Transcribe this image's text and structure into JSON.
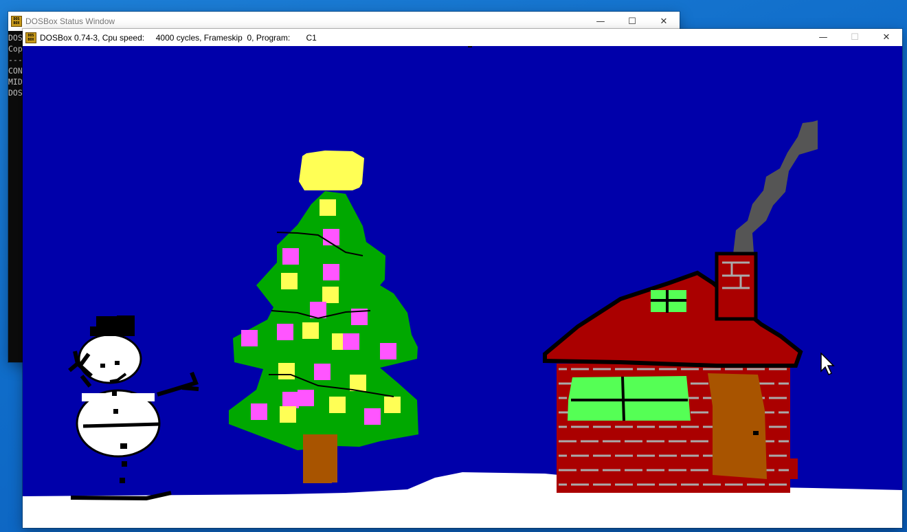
{
  "status_window": {
    "title": "DOSBox Status Window",
    "console_lines": [
      "DOS",
      "Cop",
      "---",
      "",
      "CON",
      "MID",
      "DOS"
    ],
    "controls": {
      "minimize": "—",
      "maximize": "☐",
      "close": "✕"
    }
  },
  "main_window": {
    "title": "DOSBox 0.74-3, Cpu speed:     4000 cycles, Frameskip  0, Program:       C1",
    "controls": {
      "minimize": "—",
      "maximize": "☐",
      "close": "✕"
    }
  },
  "scene": {
    "colors": {
      "sky": "#0000aa",
      "snow": "#ffffff",
      "tree": "#00a800",
      "trunk": "#a85400",
      "star": "#ffff55",
      "ornament_pink": "#ff55ff",
      "ornament_yellow": "#ffff55",
      "roof": "#aa0000",
      "brick": "#aa0000",
      "mortar": "#aaaaaa",
      "window": "#55ff55",
      "door": "#a85400",
      "smoke": "#555555",
      "outline": "#000000"
    },
    "icons": [
      "snowman-icon",
      "christmas-tree-icon",
      "house-icon",
      "mouse-cursor-icon"
    ]
  }
}
